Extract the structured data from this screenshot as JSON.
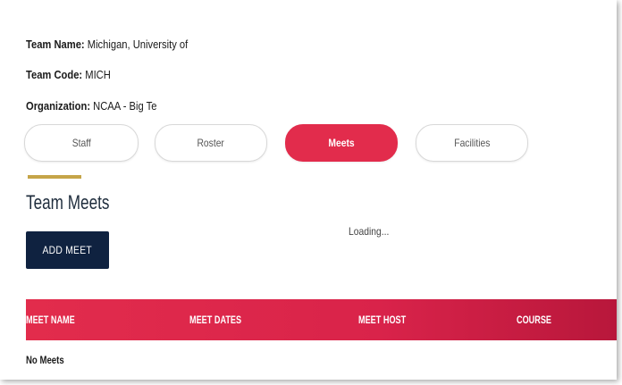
{
  "team": {
    "name_label": "Team Name:",
    "name_value": " Michigan, University of",
    "code_label": "Team Code:",
    "code_value": " MICH",
    "org_label": "Organization:",
    "org_value": " NCAA - Big Te"
  },
  "tabs": [
    {
      "label": "Staff",
      "active": false
    },
    {
      "label": "Roster",
      "active": false
    },
    {
      "label": "Meets",
      "active": true
    },
    {
      "label": "Facilities",
      "active": false
    }
  ],
  "section": {
    "title": "Team Meets",
    "add_button_label": "ADD MEET",
    "loading_text": "Loading..."
  },
  "table": {
    "columns": [
      "MEET NAME",
      "MEET DATES",
      "MEET HOST",
      "COURSE"
    ],
    "empty_text": "No Meets"
  },
  "colors": {
    "accent_red": "#e22c4c",
    "navy": "#0f2240",
    "gold": "#c5a548"
  }
}
